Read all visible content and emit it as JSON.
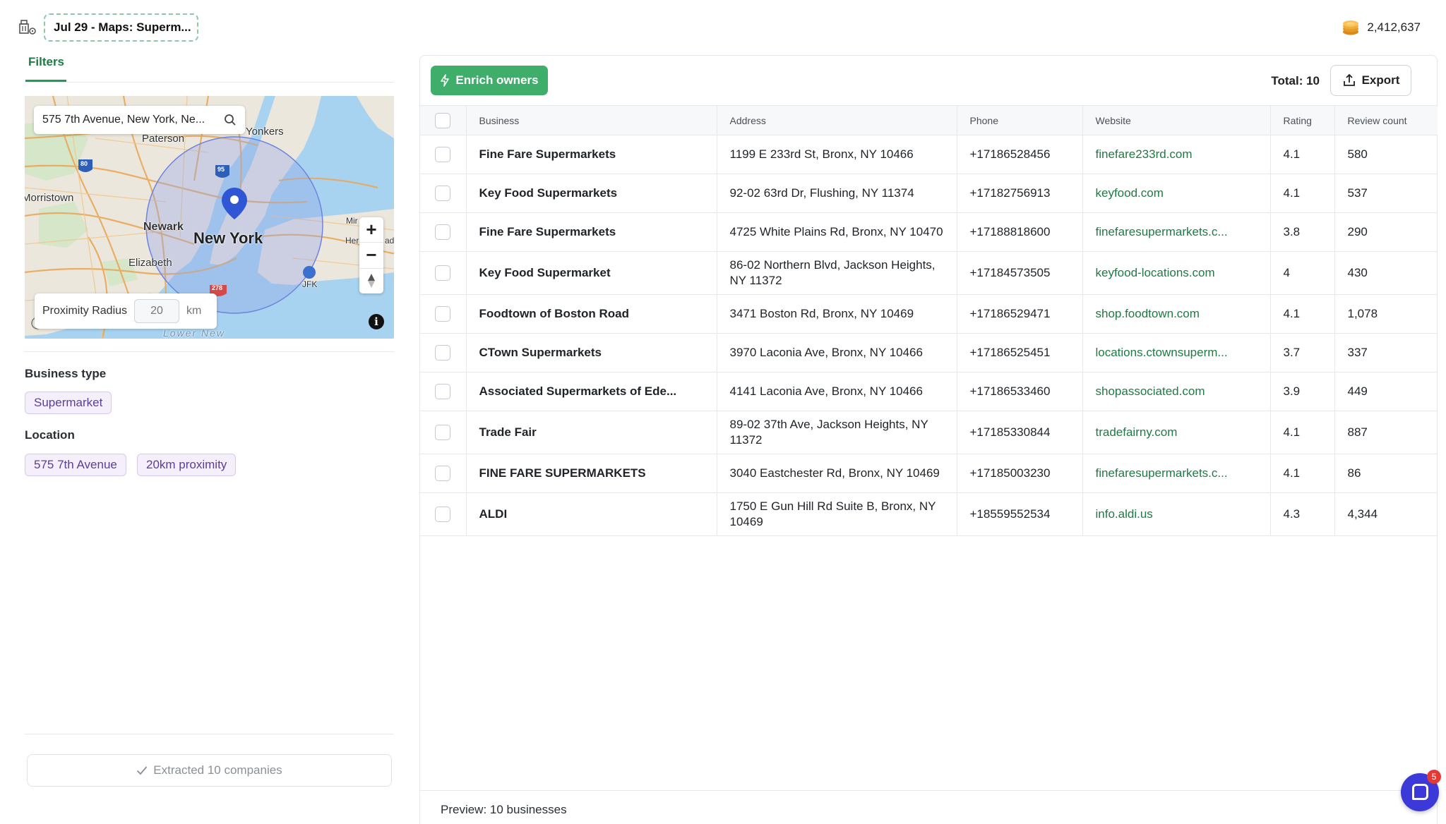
{
  "header": {
    "title": "Jul 29 - Maps: Superm...",
    "credits": "2,412,637"
  },
  "filters": {
    "tab_label": "Filters",
    "map": {
      "search_value": "575 7th Avenue, New York, Ne...",
      "labels": {
        "paterson": "Paterson",
        "yonkers": "Yonkers",
        "morristown": "Morristown",
        "newark": "Newark",
        "new_york": "New York",
        "elizabeth": "Elizabeth",
        "mir": "Mir",
        "her": "Her",
        "ad": "ad",
        "jfk": "JFK",
        "lower_new": "Lower New",
        "hwy_80": "80",
        "hwy_95": "95",
        "hwy_278": "278"
      },
      "zoom_in": "+",
      "zoom_out": "−",
      "info": "i",
      "radius_label": "Proximity Radius",
      "radius_value": "20",
      "radius_unit": "km"
    },
    "business_type_label": "Business type",
    "business_type_chip": "Supermarket",
    "location_label": "Location",
    "location_chips": [
      "575 7th Avenue",
      "20km proximity"
    ],
    "extracted_text": "Extracted 10 companies"
  },
  "results": {
    "enrich_label": "Enrich owners",
    "total": "Total: 10",
    "export_label": "Export",
    "columns": [
      "Business",
      "Address",
      "Phone",
      "Website",
      "Rating",
      "Review count"
    ],
    "rows": [
      {
        "business": "Fine Fare Supermarkets",
        "address": "1199 E 233rd St, Bronx, NY 10466",
        "phone": "+17186528456",
        "website": "finefare233rd.com",
        "rating": "4.1",
        "reviews": "580"
      },
      {
        "business": "Key Food Supermarkets",
        "address": "92-02 63rd Dr, Flushing, NY 11374",
        "phone": "+17182756913",
        "website": "keyfood.com",
        "rating": "4.1",
        "reviews": "537"
      },
      {
        "business": "Fine Fare Supermarkets",
        "address": "4725 White Plains Rd, Bronx, NY 10470",
        "phone": "+17188818600",
        "website": "finefaresupermarkets.c...",
        "rating": "3.8",
        "reviews": "290"
      },
      {
        "business": "Key Food Supermarket",
        "address": "86-02 Northern Blvd, Jackson Heights, NY 11372",
        "phone": "+17184573505",
        "website": "keyfood-locations.com",
        "rating": "4",
        "reviews": "430"
      },
      {
        "business": "Foodtown of Boston Road",
        "address": "3471 Boston Rd, Bronx, NY 10469",
        "phone": "+17186529471",
        "website": "shop.foodtown.com",
        "rating": "4.1",
        "reviews": "1,078"
      },
      {
        "business": "CTown Supermarkets",
        "address": "3970 Laconia Ave, Bronx, NY 10466",
        "phone": "+17186525451",
        "website": "locations.ctownsuperm...",
        "rating": "3.7",
        "reviews": "337"
      },
      {
        "business": "Associated Supermarkets of Ede...",
        "address": "4141 Laconia Ave, Bronx, NY 10466",
        "phone": "+17186533460",
        "website": "shopassociated.com",
        "rating": "3.9",
        "reviews": "449"
      },
      {
        "business": "Trade Fair",
        "address": "89-02 37th Ave, Jackson Heights, NY 11372",
        "phone": "+17185330844",
        "website": "tradefairny.com",
        "rating": "4.1",
        "reviews": "887"
      },
      {
        "business": "FINE FARE SUPERMARKETS",
        "address": "3040 Eastchester Rd, Bronx, NY 10469",
        "phone": "+17185003230",
        "website": "finefaresupermarkets.c...",
        "rating": "4.1",
        "reviews": "86"
      },
      {
        "business": "ALDI",
        "address": "1750 E Gun Hill Rd Suite B, Bronx, NY 10469",
        "phone": "+18559552534",
        "website": "info.aldi.us",
        "rating": "4.3",
        "reviews": "4,344"
      }
    ],
    "preview": "Preview: 10 businesses"
  },
  "chat": {
    "badge": "5"
  },
  "colors": {
    "accent_green": "#3fae6b",
    "link_green": "#1f7a44",
    "chip_purple": "#5b3e96",
    "chat_blue": "#3b3ad8",
    "badge_red": "#e53935"
  }
}
